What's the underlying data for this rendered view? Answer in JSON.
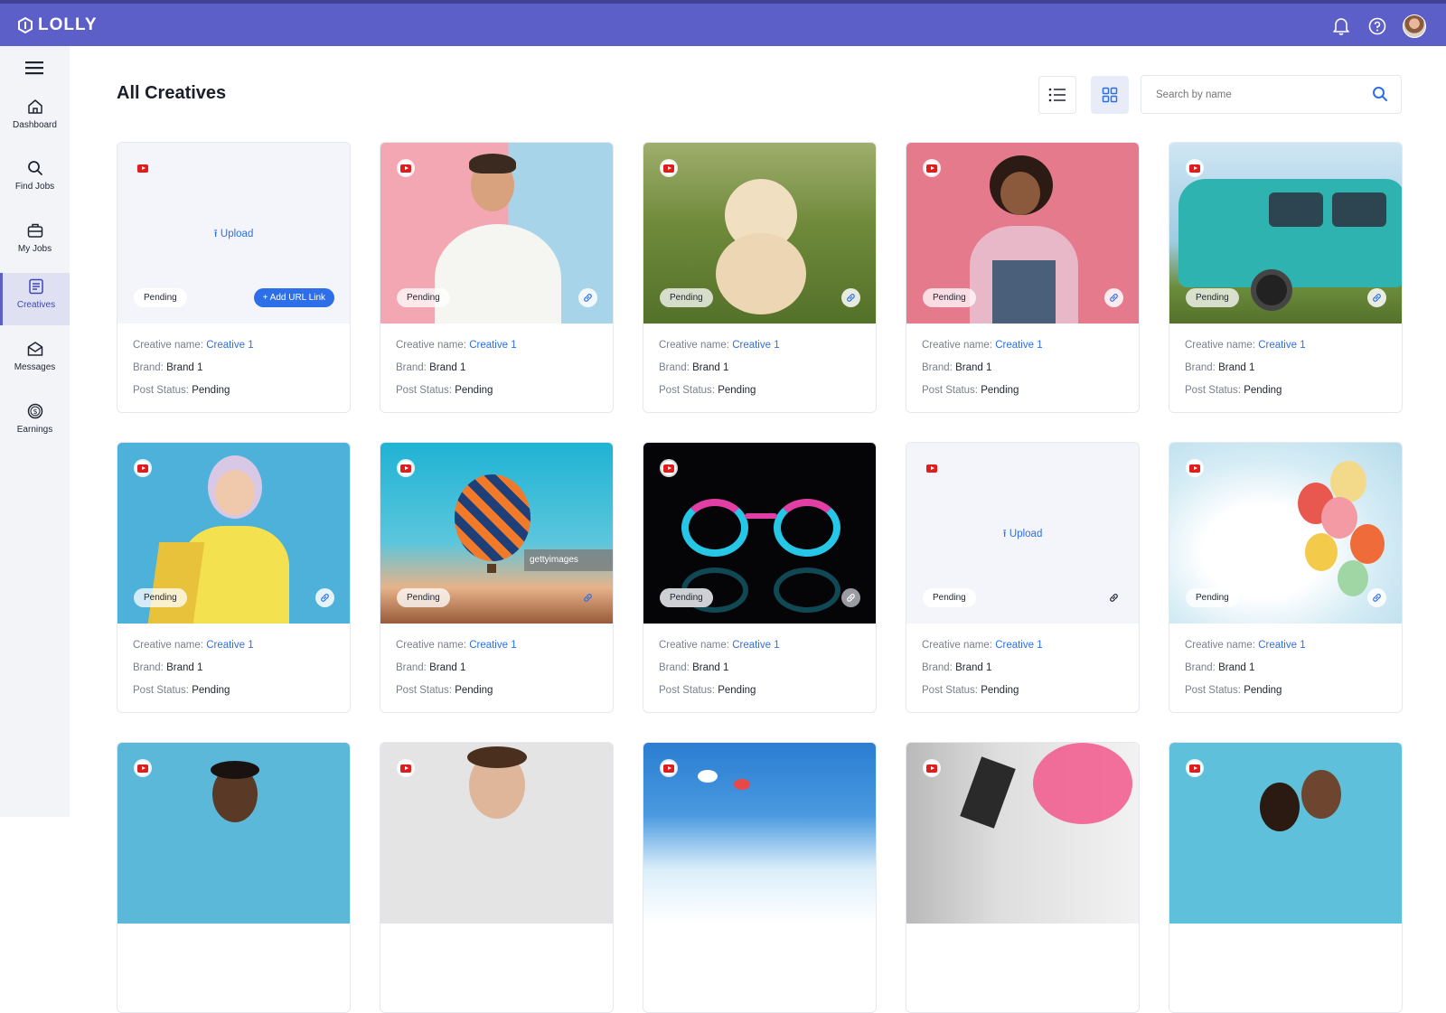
{
  "app": {
    "name": "LOLLY"
  },
  "sidebar": {
    "items": [
      {
        "label": "Dashboard",
        "icon": "home-icon"
      },
      {
        "label": "Find Jobs",
        "icon": "search-icon"
      },
      {
        "label": "My Jobs",
        "icon": "briefcase-icon"
      },
      {
        "label": "Creatives",
        "icon": "creatives-icon",
        "active": true
      },
      {
        "label": "Messages",
        "icon": "envelope-icon"
      },
      {
        "label": "Earnings",
        "icon": "dollar-coin-icon"
      }
    ]
  },
  "header": {
    "title": "All Creatives",
    "search_placeholder": "Search by name"
  },
  "card_labels": {
    "creative_name": "Creative name:",
    "brand": "Brand:",
    "post_status": "Post Status:",
    "upload": "Upload",
    "add_url": "Add URL Link"
  },
  "cards": [
    {
      "media": "empty-upload",
      "status": "Pending",
      "creative": "Creative 1",
      "brand": "Brand 1",
      "post_status": "Pending"
    },
    {
      "media": "excited-man-photo",
      "status": "Pending",
      "creative": "Creative 1",
      "brand": "Brand 1",
      "post_status": "Pending"
    },
    {
      "media": "puppy-photo",
      "status": "Pending",
      "creative": "Creative 1",
      "brand": "Brand 1",
      "post_status": "Pending"
    },
    {
      "media": "dancing-woman-photo",
      "status": "Pending",
      "creative": "Creative 1",
      "brand": "Brand 1",
      "post_status": "Pending"
    },
    {
      "media": "teal-van-photo",
      "status": "Pending",
      "creative": "Creative 1",
      "brand": "Brand 1",
      "post_status": "Pending"
    },
    {
      "media": "shopping-woman-photo",
      "status": "Pending",
      "creative": "Creative 1",
      "brand": "Brand 1",
      "post_status": "Pending"
    },
    {
      "media": "hot-air-balloon-photo",
      "status": "Pending",
      "creative": "Creative 1",
      "brand": "Brand 1",
      "post_status": "Pending",
      "watermark": "gettyimages"
    },
    {
      "media": "neon-glasses-photo",
      "status": "Pending",
      "creative": "Creative 1",
      "brand": "Brand 1",
      "post_status": "Pending"
    },
    {
      "media": "empty-upload-link",
      "status": "Pending",
      "creative": "Creative 1",
      "brand": "Brand 1",
      "post_status": "Pending"
    },
    {
      "media": "balloons-photo",
      "status": "Pending",
      "creative": "Creative 1",
      "brand": "Brand 1",
      "post_status": "Pending"
    },
    {
      "media": "man-portrait-photo"
    },
    {
      "media": "bearded-man-photo"
    },
    {
      "media": "skydivers-photo"
    },
    {
      "media": "pink-smoke-photo"
    },
    {
      "media": "couple-photo"
    }
  ]
}
